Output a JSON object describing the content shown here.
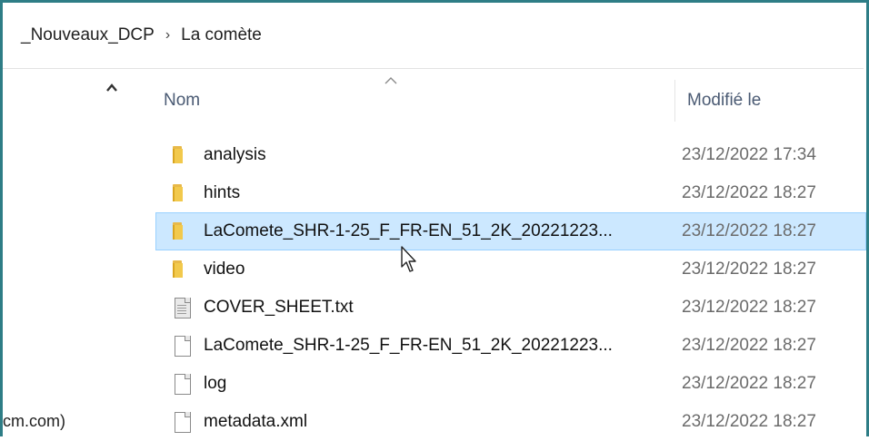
{
  "breadcrumb": {
    "parent": "_Nouveaux_DCP",
    "separator": "›",
    "current": "La comète"
  },
  "nav": {
    "partial_text": "cm.com)"
  },
  "columns": {
    "name": "Nom",
    "modified": "Modifié le"
  },
  "files": [
    {
      "name": "analysis",
      "date": "23/12/2022 17:34",
      "type": "folder",
      "selected": false
    },
    {
      "name": "hints",
      "date": "23/12/2022 18:27",
      "type": "folder",
      "selected": false
    },
    {
      "name": "LaComete_SHR-1-25_F_FR-EN_51_2K_20221223...",
      "date": "23/12/2022 18:27",
      "type": "folder",
      "selected": true
    },
    {
      "name": "video",
      "date": "23/12/2022 18:27",
      "type": "folder",
      "selected": false
    },
    {
      "name": "COVER_SHEET.txt",
      "date": "23/12/2022 18:27",
      "type": "text",
      "selected": false
    },
    {
      "name": "LaComete_SHR-1-25_F_FR-EN_51_2K_20221223...",
      "date": "23/12/2022 18:27",
      "type": "file",
      "selected": false
    },
    {
      "name": "log",
      "date": "23/12/2022 18:27",
      "type": "file",
      "selected": false
    },
    {
      "name": "metadata.xml",
      "date": "23/12/2022 18:27",
      "type": "file",
      "selected": false
    }
  ],
  "colors": {
    "frame": "#2e7d86",
    "selection": "#cce8ff",
    "folder": "#f2c94c"
  }
}
